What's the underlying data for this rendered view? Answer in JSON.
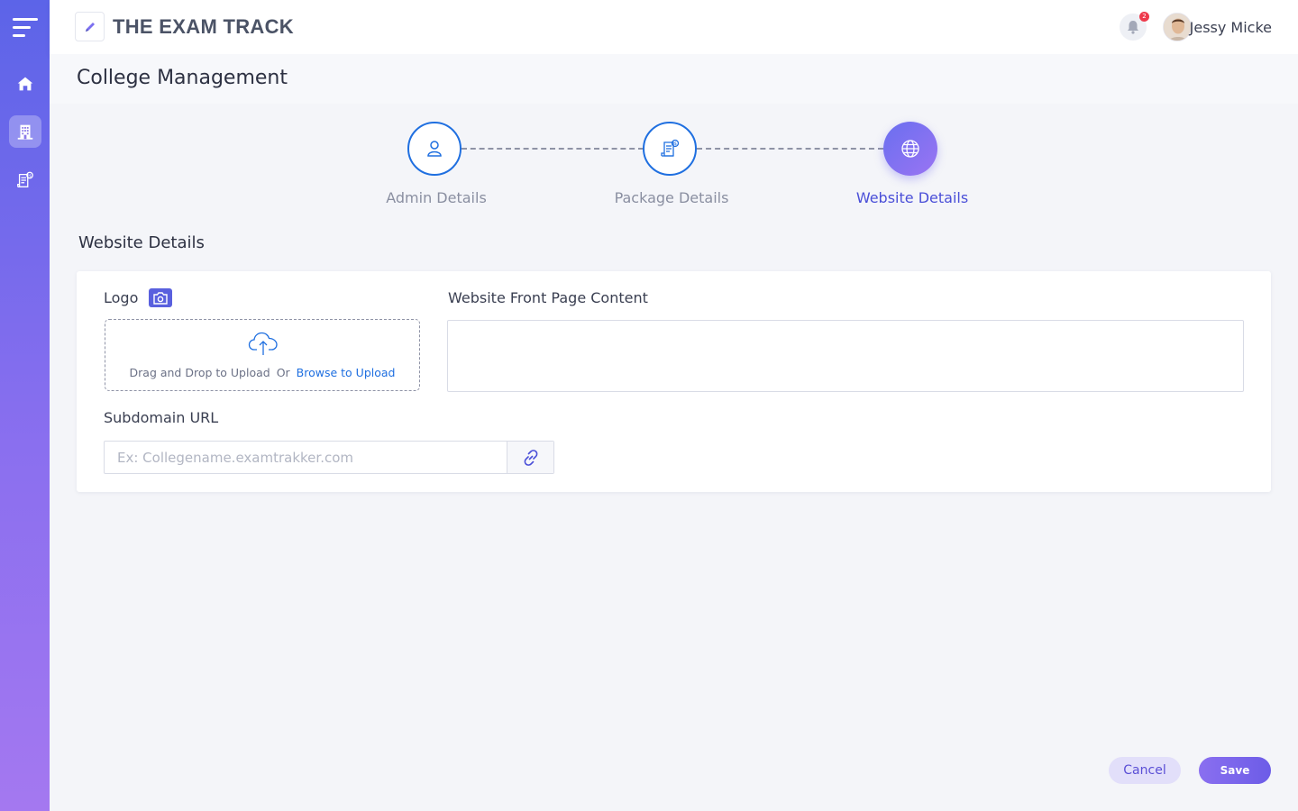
{
  "app": {
    "brand": "THE EXAM TRACK",
    "notification_count": "2",
    "user_name": "Jessy Micke"
  },
  "sidebar": {
    "items": [
      {
        "icon": "home-icon"
      },
      {
        "icon": "building-icon",
        "active": true
      },
      {
        "icon": "invoice-icon"
      }
    ]
  },
  "page": {
    "title": "College Management"
  },
  "stepper": {
    "steps": [
      {
        "label": "Admin Details",
        "icon": "user-icon",
        "state": "completed"
      },
      {
        "label": "Package Details",
        "icon": "package-invoice-icon",
        "state": "completed"
      },
      {
        "label": "Website Details",
        "icon": "globe-icon",
        "state": "active"
      }
    ]
  },
  "section": {
    "title": "Website Details",
    "logo_label": "Logo",
    "dropzone_text": "Drag and Drop to Upload",
    "dropzone_or": "Or",
    "dropzone_link": "Browse to Upload",
    "content_label": "Website Front Page Content",
    "content_value": "",
    "subdomain_label": "Subdomain URL",
    "subdomain_placeholder": "Ex: Collegename.examtrakker.com",
    "subdomain_value": ""
  },
  "actions": {
    "cancel": "Cancel",
    "save": "Save"
  },
  "colors": {
    "accent": "#5960de",
    "link": "#1f6fe0",
    "sidebar_top": "#5c64e8",
    "sidebar_bottom": "#a478f0"
  }
}
